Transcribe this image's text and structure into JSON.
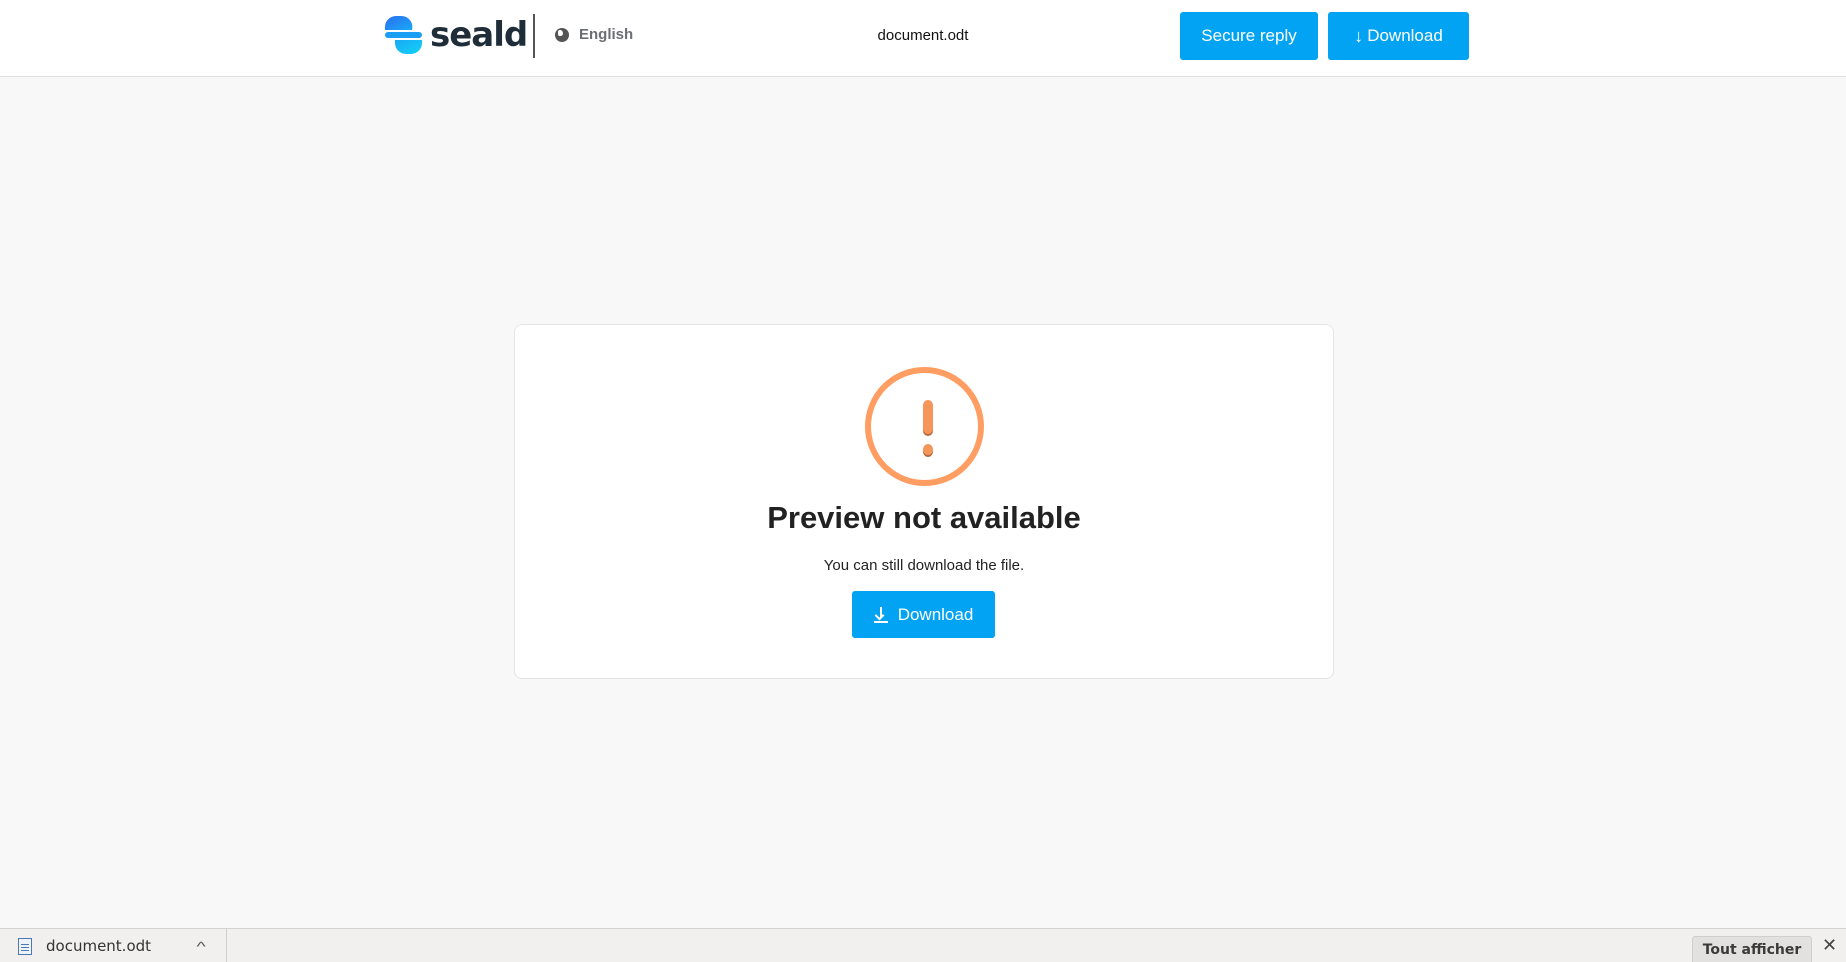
{
  "header": {
    "brand": "seald",
    "language": "English",
    "filename": "document.odt",
    "secure_reply_label": "Secure reply",
    "download_label": "Download"
  },
  "card": {
    "icon": "warning-circle-icon",
    "title": "Preview not available",
    "subtitle": "You can still download the file.",
    "download_label": "Download"
  },
  "download_bar": {
    "item_name": "document.odt",
    "show_all_label": "Tout afficher"
  },
  "colors": {
    "accent": "#02a3f2",
    "warning": "#ff9d62",
    "brand_text": "#1f2d38"
  }
}
